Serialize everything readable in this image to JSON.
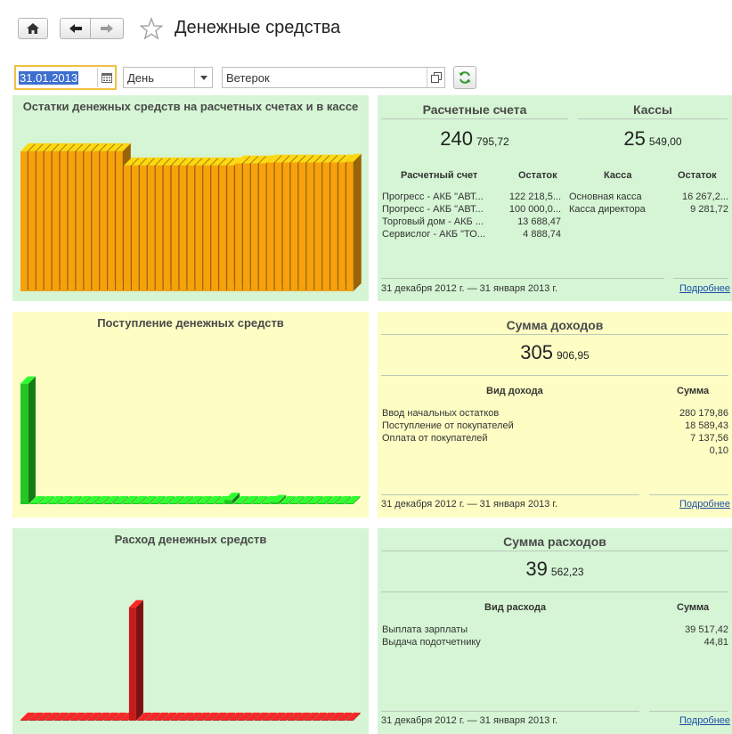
{
  "header": {
    "title": "Денежные средства",
    "nav": {
      "home_icon": "home-icon",
      "back_icon": "arrow-left-icon",
      "forward_icon": "arrow-right-icon",
      "favorite_icon": "star-icon"
    }
  },
  "filters": {
    "date": "31.01.2013",
    "period": "День",
    "organization": "Ветерок",
    "icons": {
      "calendar": "calendar-icon",
      "dropdown": "chevron-down-icon",
      "open": "open-form-icon",
      "refresh": "refresh-icon"
    }
  },
  "colors": {
    "green_panel": "#d5f5d4",
    "yellow_panel": "#fdfdc4",
    "orange_bars": "#f7a10c",
    "green_bars": "#22c722",
    "red_bars": "#c41c1c",
    "link": "#1e4fa8"
  },
  "charts": {
    "balance": {
      "title": "Остатки денежных средств на расчетных счетах и в кассе",
      "chart_data": {
        "type": "bar",
        "title": "Остатки денежных средств на расчетных счетах и в кассе",
        "values": [
          305,
          305,
          305,
          305,
          305,
          305,
          305,
          305,
          305,
          305,
          305,
          305,
          305,
          274,
          274,
          274,
          274,
          274,
          274,
          274,
          274,
          274,
          274,
          274,
          274,
          274,
          274,
          278,
          278,
          278,
          278,
          280,
          280,
          280,
          280,
          280,
          280,
          280,
          280,
          280,
          280,
          282
        ],
        "ylim": [
          0,
          320
        ],
        "grid": false,
        "legend": "none"
      }
    },
    "income": {
      "title": "Поступление денежных средств",
      "chart_data": {
        "type": "bar",
        "title": "Поступление денежных средств",
        "values": [
          280,
          0.6,
          0.6,
          0.6,
          0.6,
          0.6,
          0.6,
          0.6,
          0.6,
          0.6,
          0.6,
          0.6,
          0.6,
          0.6,
          0.6,
          0.6,
          0.6,
          0.6,
          0.6,
          0.6,
          0.6,
          0.6,
          10,
          0.6,
          0.6,
          0.6,
          0.6,
          5,
          0.6,
          0.6,
          0.6,
          0.6,
          0.6,
          0.6,
          0.6,
          0.6
        ],
        "ylim": [
          0,
          300
        ],
        "grid": false,
        "legend": "none"
      }
    },
    "expense": {
      "title": "Расход денежных средств",
      "chart_data": {
        "type": "bar",
        "title": "Расход денежных средств",
        "values": [
          0.2,
          0.2,
          0.2,
          0.2,
          0.2,
          0.2,
          0.2,
          0.2,
          0.2,
          0.2,
          0.2,
          0.2,
          0.2,
          39.5,
          0.2,
          0.2,
          0.2,
          0.2,
          0.2,
          0.2,
          0.2,
          0.2,
          0.2,
          0.2,
          0.2,
          0.2,
          0.2,
          0.2,
          0.2,
          0.2,
          0.2,
          0.2,
          0.2,
          0.2,
          0.2,
          0.2,
          0.2,
          0.2,
          0.2,
          0.2
        ],
        "ylim": [
          0,
          45
        ],
        "grid": false,
        "legend": "none"
      }
    }
  },
  "balances": {
    "accounts": {
      "heading": "Расчетные счета",
      "total_int": "240",
      "total_frac": "795,72",
      "col_name": "Расчетный счет",
      "col_value": "Остаток",
      "rows": [
        {
          "name": "Прогресс - АКБ \"АВТ...",
          "value": "122 218,5..."
        },
        {
          "name": "Прогресс - АКБ \"АВТ...",
          "value": "100 000,0..."
        },
        {
          "name": "Торговый дом - АКБ ...",
          "value": "13 688,47"
        },
        {
          "name": "Сервислог - АКБ \"ТО...",
          "value": "4 888,74"
        }
      ]
    },
    "cash": {
      "heading": "Кассы",
      "total_int": "25",
      "total_frac": "549,00",
      "col_name": "Касса",
      "col_value": "Остаток",
      "rows": [
        {
          "name": "Основная касса",
          "value": "16 267,2..."
        },
        {
          "name": "Касса директора",
          "value": "9 281,72"
        }
      ]
    },
    "period": "31 декабря 2012 г. — 31 января 2013 г.",
    "more": "Подробнее"
  },
  "income_summary": {
    "heading": "Сумма доходов",
    "total_int": "305",
    "total_frac": "906,95",
    "col_name": "Вид дохода",
    "col_value": "Сумма",
    "rows": [
      {
        "name": "Ввод начальных остатков",
        "value": "280 179,86"
      },
      {
        "name": "Поступление от покупателей",
        "value": "18 589,43"
      },
      {
        "name": "Оплата от покупателей",
        "value": "7 137,56"
      },
      {
        "name": "",
        "value": "0,10"
      }
    ],
    "period": "31 декабря 2012 г. — 31 января 2013 г.",
    "more": "Подробнее"
  },
  "expense_summary": {
    "heading": "Сумма расходов",
    "total_int": "39",
    "total_frac": "562,23",
    "col_name": "Вид расхода",
    "col_value": "Сумма",
    "rows": [
      {
        "name": "Выплата зарплаты",
        "value": "39 517,42"
      },
      {
        "name": "Выдача подотчетнику",
        "value": "44,81"
      }
    ],
    "period": "31 декабря 2012 г. — 31 января 2013 г.",
    "more": "Подробнее"
  }
}
